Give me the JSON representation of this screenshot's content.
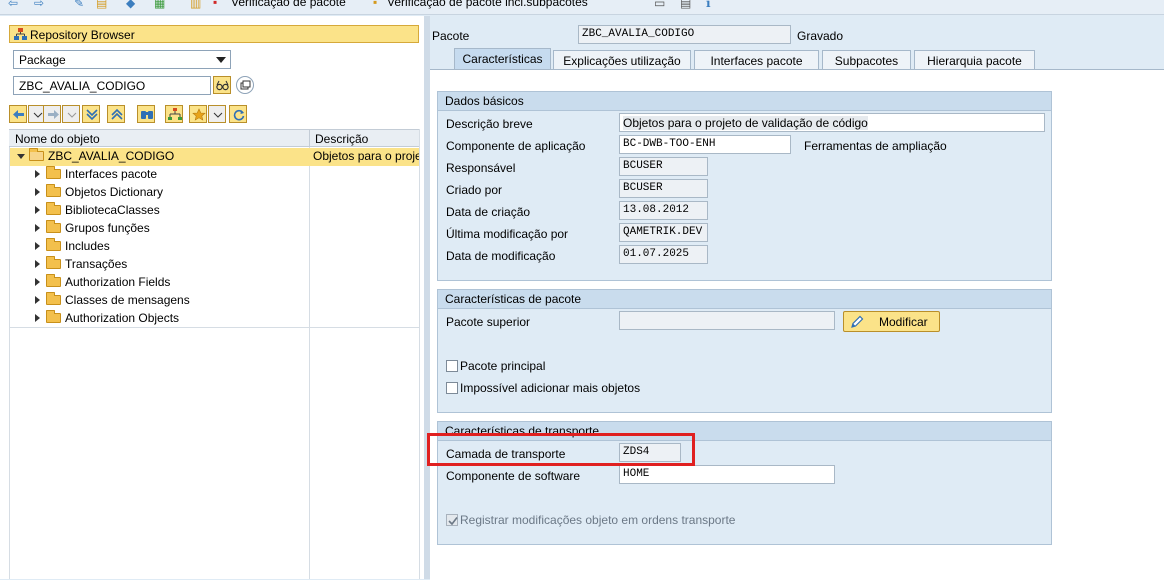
{
  "toolbar": {
    "pkg_check_label": "Verificação de pacote",
    "pkg_check_sub_label": "Verificação de pacote incl.subpacotes"
  },
  "navigator": {
    "repository_browser_label": "Repository Browser",
    "object_type_selected": "Package",
    "object_name_value": "ZBC_AVALIA_CODIGO",
    "tree": {
      "col_name": "Nome do objeto",
      "col_desc": "Descrição",
      "root_label": "ZBC_AVALIA_CODIGO",
      "root_desc": "Objetos para o projeto de validação de código",
      "items": [
        {
          "label": "Interfaces pacote"
        },
        {
          "label": "Objetos Dictionary"
        },
        {
          "label": "BibliotecaClasses"
        },
        {
          "label": "Grupos funções"
        },
        {
          "label": "Includes"
        },
        {
          "label": "Transações"
        },
        {
          "label": "Authorization Fields"
        },
        {
          "label": "Classes de mensagens"
        },
        {
          "label": "Authorization Objects"
        }
      ]
    }
  },
  "package_header": {
    "label": "Pacote",
    "value": "ZBC_AVALIA_CODIGO",
    "status": "Gravado"
  },
  "tabs": [
    {
      "label": "Características",
      "active": true
    },
    {
      "label": "Explicações utilização",
      "active": false
    },
    {
      "label": "Interfaces pacote",
      "active": false
    },
    {
      "label": "Subpacotes",
      "active": false
    },
    {
      "label": "Hierarquia pacote",
      "active": false
    }
  ],
  "basic_data": {
    "title": "Dados básicos",
    "short_desc_label": "Descrição breve",
    "short_desc_value": "Objetos para o projeto de validação de código",
    "app_component_label": "Componente de aplicação",
    "app_component_value": "BC-DWB-TOO-ENH",
    "app_component_text": "Ferramentas de ampliação",
    "responsible_label": "Responsável",
    "responsible_value": "BCUSER",
    "created_by_label": "Criado por",
    "created_by_value": "BCUSER",
    "created_on_label": "Data de criação",
    "created_on_value": "13.08.2012",
    "last_changed_by_label": "Última modificação por",
    "last_changed_by_value": "QAMETRIK.DEV",
    "changed_on_label": "Data de modificação",
    "changed_on_value": "01.07.2025"
  },
  "package_props": {
    "title": "Características de pacote",
    "super_package_label": "Pacote superior",
    "super_package_value": "",
    "modify_label": "Modificar",
    "main_package_label": "Pacote principal",
    "main_package_checked": false,
    "no_more_objects_label": "Impossível adicionar mais objetos",
    "no_more_objects_checked": false
  },
  "transport": {
    "title": "Características de transporte",
    "layer_label": "Camada de transporte",
    "layer_value": "ZDS4",
    "software_component_label": "Componente de software",
    "software_component_value": "HOME",
    "record_changes_label": "Registrar modificações objeto em ordens transporte",
    "record_changes_checked": true
  },
  "colors": {
    "highlight": "#e02020",
    "accent_yellow": "#fbe389",
    "panel_bg": "#dfebf5"
  }
}
